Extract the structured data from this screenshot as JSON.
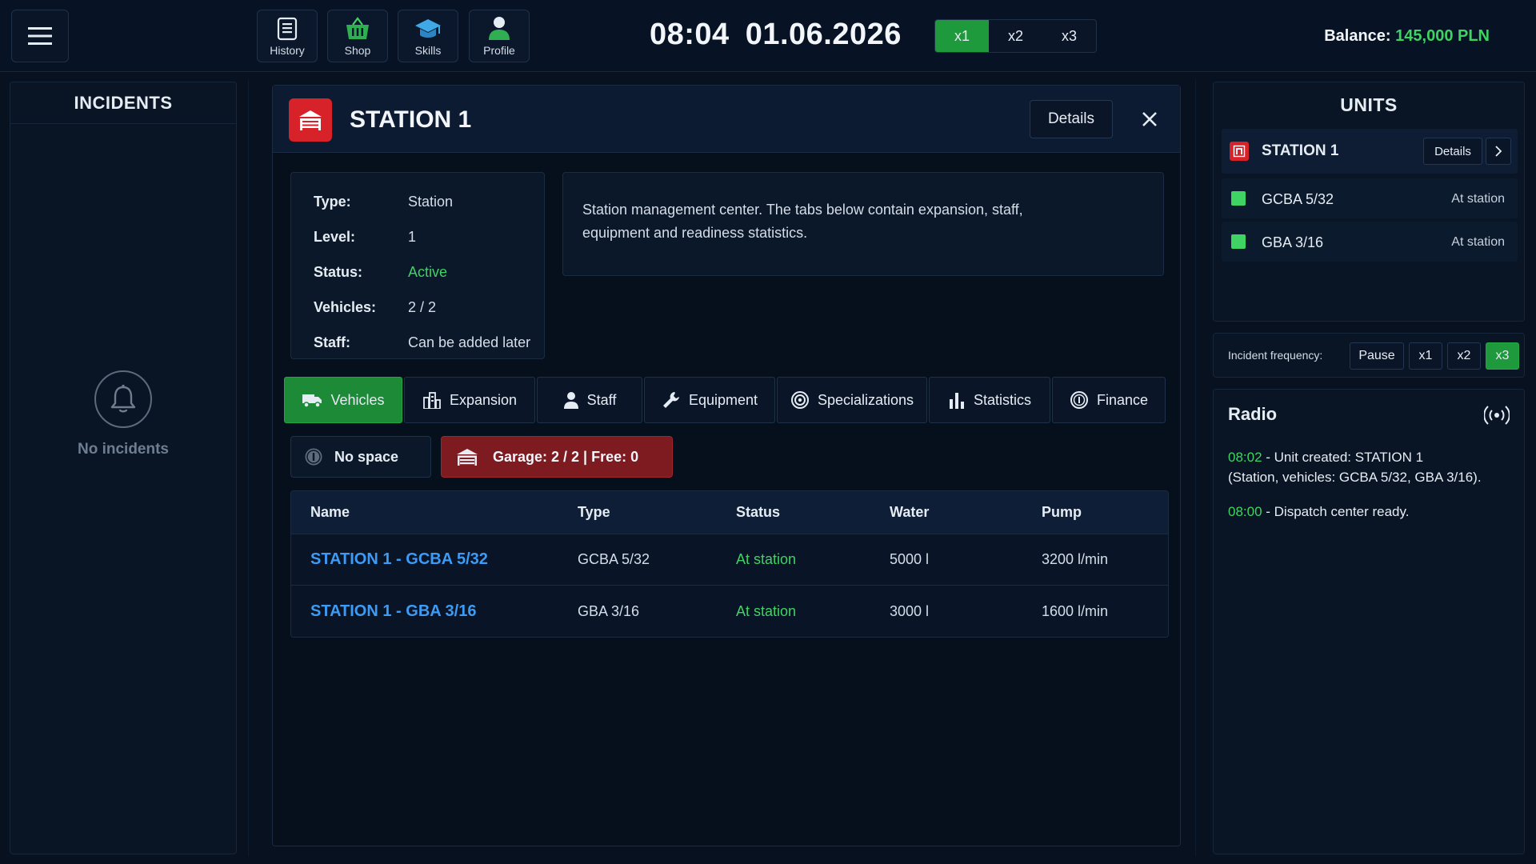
{
  "topbar": {
    "nav": [
      {
        "label": "History",
        "icon": "history-icon"
      },
      {
        "label": "Shop",
        "icon": "shop-basket-icon"
      },
      {
        "label": "Skills",
        "icon": "graduation-cap-icon"
      },
      {
        "label": "Profile",
        "icon": "profile-person-icon"
      }
    ],
    "time": "08:04",
    "date": "01.06.2026",
    "speeds": [
      "x1",
      "x2",
      "x3"
    ],
    "active_speed": "x1",
    "balance_label": "Balance:",
    "balance_value": "145,000 PLN"
  },
  "incidents": {
    "title": "INCIDENTS",
    "empty_text": "No incidents"
  },
  "station": {
    "title": "STATION 1",
    "details_label": "Details",
    "info": [
      {
        "key": "Type:",
        "value": "Station"
      },
      {
        "key": "Level:",
        "value": "1"
      },
      {
        "key": "Status:",
        "value": "Active"
      },
      {
        "key": "Vehicles:",
        "value": "2 / 2"
      },
      {
        "key": "Staff:",
        "value": "Can be added later"
      }
    ],
    "description_line1": "Station management center. The tabs below contain expansion, staff,",
    "description_line2": "equipment and readiness statistics.",
    "tabs": [
      {
        "label": "Vehicles",
        "icon": "truck-icon"
      },
      {
        "label": "Expansion",
        "icon": "buildings-icon"
      },
      {
        "label": "Staff",
        "icon": "person-icon"
      },
      {
        "label": "Equipment",
        "icon": "wrench-icon"
      },
      {
        "label": "Specializations",
        "icon": "target-icon"
      },
      {
        "label": "Statistics",
        "icon": "bar-chart-icon"
      },
      {
        "label": "Finance",
        "icon": "coin-icon"
      }
    ],
    "no_space_label": "No space",
    "garage_label": "Garage: 2 / 2 | Free: 0",
    "table": {
      "headers": [
        "Name",
        "Type",
        "Status",
        "Water",
        "Pump"
      ],
      "rows": [
        {
          "name": "STATION 1 - GCBA 5/32",
          "type": "GCBA 5/32",
          "status": "At station",
          "water": "5000 l",
          "pump": "3200 l/min"
        },
        {
          "name": "STATION 1 - GBA 3/16",
          "type": "GBA 3/16",
          "status": "At station",
          "water": "3000 l",
          "pump": "1600 l/min"
        }
      ]
    }
  },
  "units": {
    "title": "UNITS",
    "station_name": "STATION 1",
    "details_label": "Details",
    "vehicles": [
      {
        "name": "GCBA 5/32",
        "status": "At station"
      },
      {
        "name": "GBA 3/16",
        "status": "At station"
      }
    ]
  },
  "frequency": {
    "label": "Incident frequency:",
    "options": [
      "Pause",
      "x1",
      "x2",
      "x3"
    ],
    "active": "x3"
  },
  "radio": {
    "title": "Radio",
    "messages": [
      {
        "time": "08:02",
        "text": " - Unit created: STATION 1",
        "text2": "(Station, vehicles: GCBA 5/32, GBA 3/16)."
      },
      {
        "time": "08:00",
        "text": " - Dispatch center ready.",
        "text2": ""
      }
    ]
  },
  "colors": {
    "accent_green": "#1e9a3c",
    "status_green": "#3fd363",
    "station_red": "#d8222a",
    "link_blue": "#3e9bf5"
  }
}
